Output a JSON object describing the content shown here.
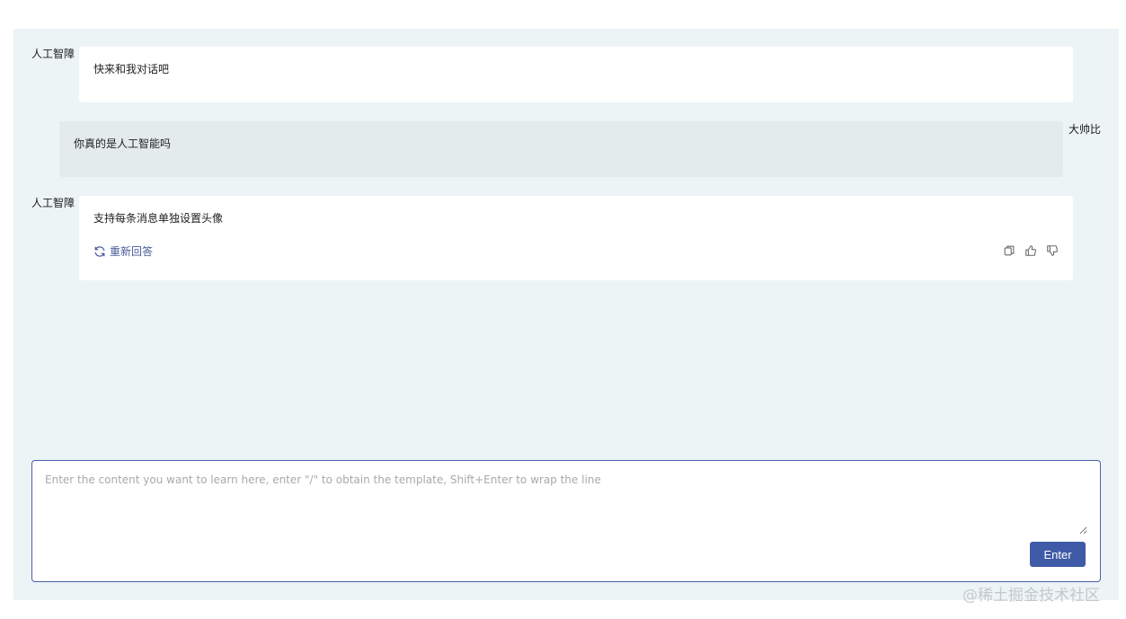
{
  "messages": [
    {
      "role": "ai",
      "sender": "人工智障",
      "text": "快来和我对话吧"
    },
    {
      "role": "user",
      "sender": "大帅比",
      "text": "你真的是人工智能吗"
    },
    {
      "role": "ai",
      "sender": "人工智障",
      "text": "支持每条消息单独设置头像",
      "regenerate_label": "重新回答"
    }
  ],
  "input": {
    "placeholder": "Enter the content you want to learn here, enter \"/\" to obtain the template, Shift+Enter to wrap the line",
    "value": "",
    "submit_label": "Enter"
  },
  "icons": {
    "regenerate": "refresh-icon",
    "copy": "copy-icon",
    "like": "thumbs-up-icon",
    "dislike": "thumbs-down-icon"
  },
  "colors": {
    "panel_bg": "#edf4f6",
    "accent": "#3f5aa6",
    "regen_text": "#4a5a9a"
  },
  "watermark": "@稀土掘金技术社区"
}
